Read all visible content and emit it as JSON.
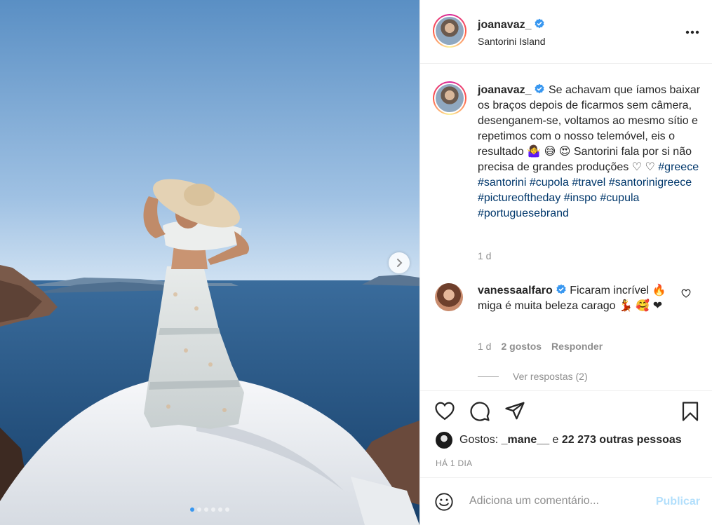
{
  "post": {
    "image_alt": "Woman in a wide sun hat and tiered skirt standing on a white dome above the Santorini caldera",
    "carousel": {
      "count": 6,
      "active_index": 0
    }
  },
  "header": {
    "username": "joanavaz_",
    "location": "Santorini Island",
    "verified": true
  },
  "caption": {
    "username": "joanavaz_",
    "text": "Se achavam que íamos baixar os braços depois de ficarmos sem câmera, desenganem-se, voltamos ao mesmo sítio e repetimos com o nosso telemóvel, eis o resultado 🤷‍♀️ 😅 😍 Santorini fala por si não precisa de grandes produções ♡ ♡",
    "hashtags": [
      "#greece",
      "#santorini",
      "#cupola",
      "#travel",
      "#santorinigreece",
      "#pictureoftheday",
      "#inspo",
      "#cupula",
      "#portuguesebrand"
    ],
    "time": "1 d"
  },
  "comment": {
    "username": "vanessaalfaro",
    "text": "Ficaram incrível 🔥 miga é muita beleza carago 💃 🥰 ❤",
    "time": "1 d",
    "likes": "2 gostos",
    "reply_label": "Responder",
    "view_replies": "Ver respostas (2)"
  },
  "likes": {
    "prefix": "Gostos:",
    "user": "_mane__",
    "connector": "e",
    "others": "22 273 outras pessoas"
  },
  "post_time": "HÁ 1 DIA",
  "add_comment": {
    "placeholder": "Adiciona um comentário...",
    "publish_label": "Publicar"
  },
  "colors": {
    "verified": "#3897f0",
    "link": "#00376b",
    "muted": "#8e8e8e",
    "publish_disabled": "#b2dffc"
  }
}
